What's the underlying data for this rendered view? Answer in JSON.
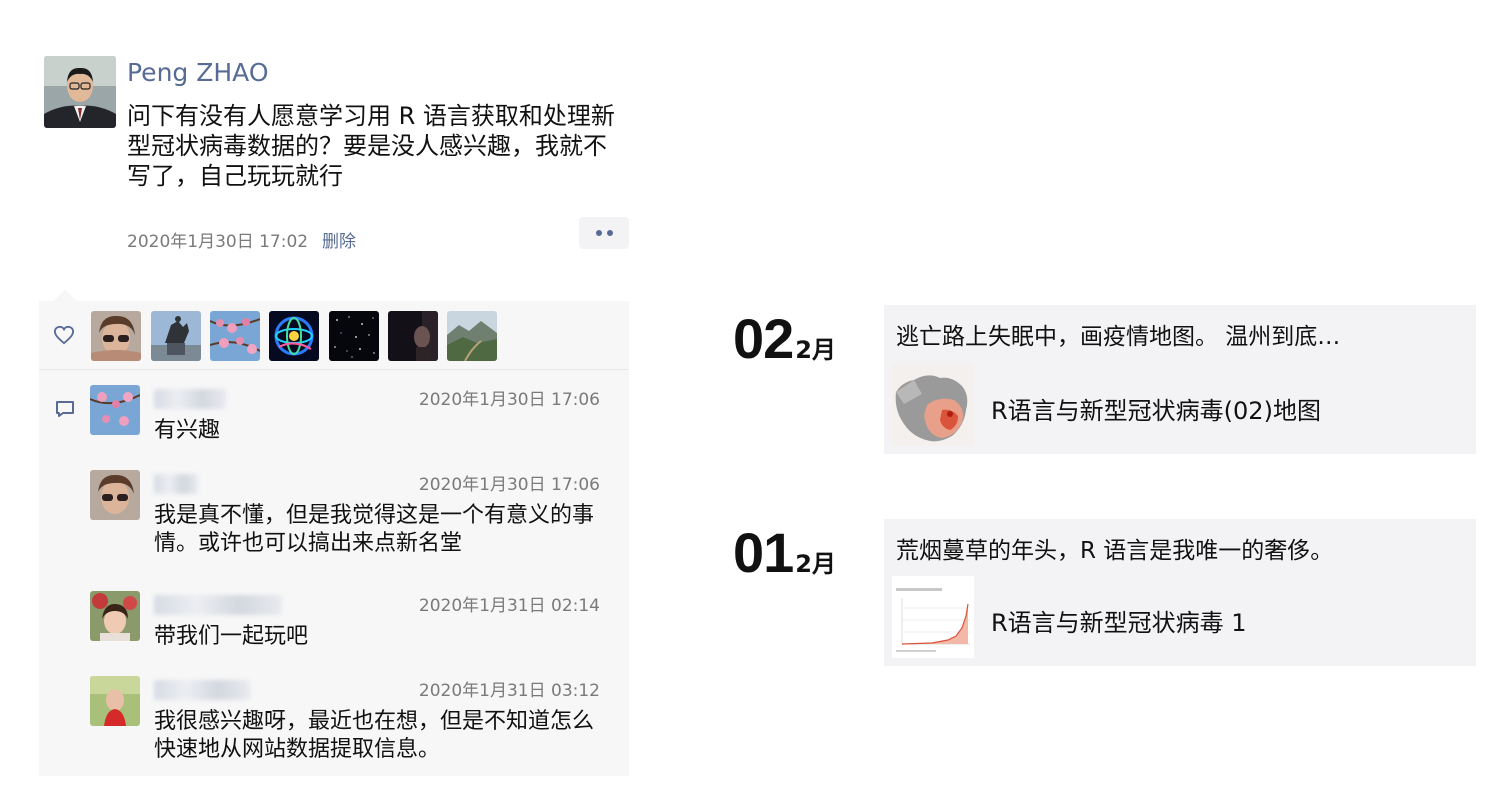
{
  "post": {
    "author": "Peng ZHAO",
    "text": "问下有没有人愿意学习用 R 语言获取和处理新型冠状病毒数据的？要是没人感兴趣，我就不写了，自己玩玩就行",
    "timestamp": "2020年1月30日 17:02",
    "delete_label": "删除",
    "more_icon": "more-dots-icon"
  },
  "likes": {
    "icon": "heart-icon",
    "count_shown": 7
  },
  "comments": [
    {
      "time": "2020年1月30日 17:06",
      "text": "有兴趣"
    },
    {
      "time": "2020年1月30日 17:06",
      "text": "我是真不懂，但是我觉得这是一个有意义的事情。或许也可以搞出来点新名堂"
    },
    {
      "time": "2020年1月31日 02:14",
      "text": "带我们一起玩吧"
    },
    {
      "time": "2020年1月31日 03:12",
      "text": "我很感兴趣呀，最近也在想，但是不知道怎么快速地从网站数据提取信息。"
    }
  ],
  "timeline": [
    {
      "day": "02",
      "month": "2月",
      "title": "逃亡路上失眠中，画疫情地图。 温州到底…",
      "link": "R语言与新型冠状病毒(02)地图"
    },
    {
      "day": "01",
      "month": "2月",
      "title": "荒烟蔓草的年头，R 语言是我唯一的奢侈。",
      "link": "R语言与新型冠状病毒 1"
    }
  ],
  "colors": {
    "link_blue": "#576b95",
    "panel_bg": "#f7f7f7",
    "card_bg": "#f3f3f5",
    "meta_gray": "#7a7a7a"
  }
}
